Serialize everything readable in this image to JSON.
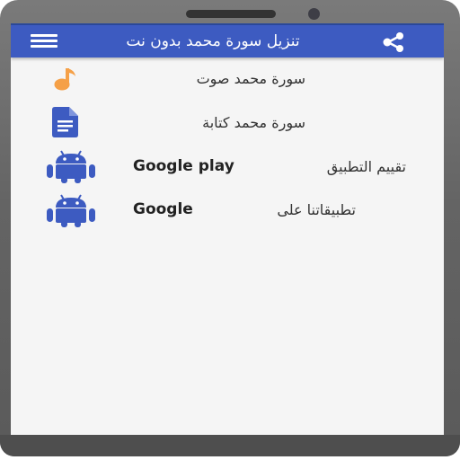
{
  "app": {
    "title": "تنزيل سورة محمد بدون نت"
  },
  "toolbar": {
    "menu_icon": "hamburger-menu-icon",
    "share_icon": "share-icon"
  },
  "menu_items": [
    {
      "label": "سورة محمد صوت",
      "icon": "music-note-icon",
      "icon_color": "#f5a047"
    },
    {
      "label": "سورة محمد كتابة",
      "icon": "document-icon",
      "icon_color": "#3d5bc1"
    },
    {
      "label_latin": "Google play",
      "label_arabic": "تقييم التطبيق",
      "icon": "android-icon",
      "icon_color": "#3d5bc1"
    },
    {
      "label_latin": "Google",
      "label_arabic": "تطبيقاتنا على",
      "icon": "android-icon",
      "icon_color": "#3d5bc1"
    }
  ],
  "colors": {
    "toolbar": "#3d5bc1",
    "accent_orange": "#f5a047",
    "background": "#f5f5f5"
  }
}
